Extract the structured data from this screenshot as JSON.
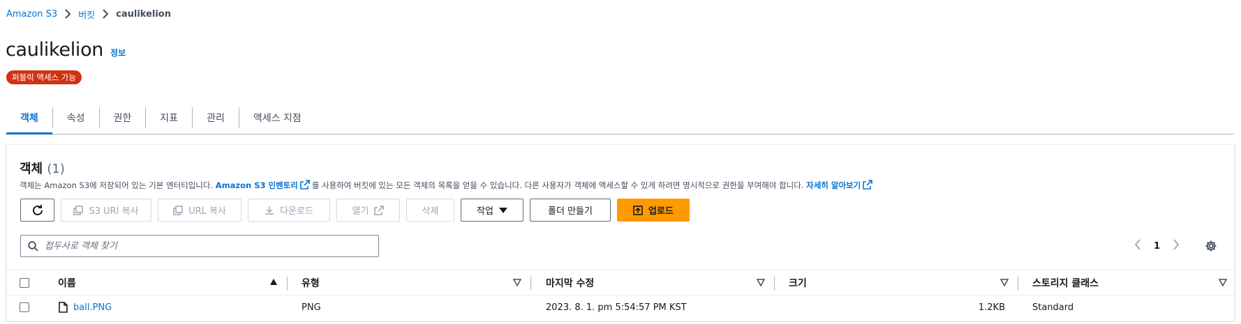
{
  "breadcrumb": {
    "items": [
      "Amazon S3",
      "버킷"
    ],
    "current": "caulikelion"
  },
  "header": {
    "title": "caulikelion",
    "info_label": "정보",
    "badge": "퍼블릭 액세스 가능"
  },
  "tabs": [
    {
      "label": "객체",
      "active": true
    },
    {
      "label": "속성",
      "active": false
    },
    {
      "label": "권한",
      "active": false
    },
    {
      "label": "지표",
      "active": false
    },
    {
      "label": "관리",
      "active": false
    },
    {
      "label": "액세스 지점",
      "active": false
    }
  ],
  "objects": {
    "title": "객체",
    "count": "(1)",
    "desc_part1": "객체는 Amazon S3에 저장되어 있는 기본 엔터티입니다. ",
    "desc_link1": "Amazon S3 인벤토리",
    "desc_part2": "를 사용하여 버킷에 있는 모든 객체의 목록을 얻을 수 있습니다. 다른 사용자가 객체에 액세스할 수 있게 하려면 명시적으로 권한을 부여해야 합니다. ",
    "desc_link2": "자세히 알아보기"
  },
  "toolbar": {
    "copy_s3_uri": "S3 URI 복사",
    "copy_url": "URL 복사",
    "download": "다운로드",
    "open": "열기",
    "delete": "삭제",
    "actions": "작업",
    "create_folder": "폴더 만들기",
    "upload": "업로드"
  },
  "search": {
    "placeholder": "접두사로 객체 찾기"
  },
  "pagination": {
    "page": "1"
  },
  "table": {
    "headers": [
      "이름",
      "유형",
      "마지막 수정",
      "크기",
      "스토리지 클래스"
    ],
    "rows": [
      {
        "name": "ball.PNG",
        "type": "PNG",
        "modified": "2023. 8. 1. pm 5:54:57 PM KST",
        "size": "1.2KB",
        "storage_class": "Standard"
      }
    ]
  },
  "colors": {
    "link": "#0972d3",
    "badge": "#d13212",
    "primary": "#ff9900"
  }
}
